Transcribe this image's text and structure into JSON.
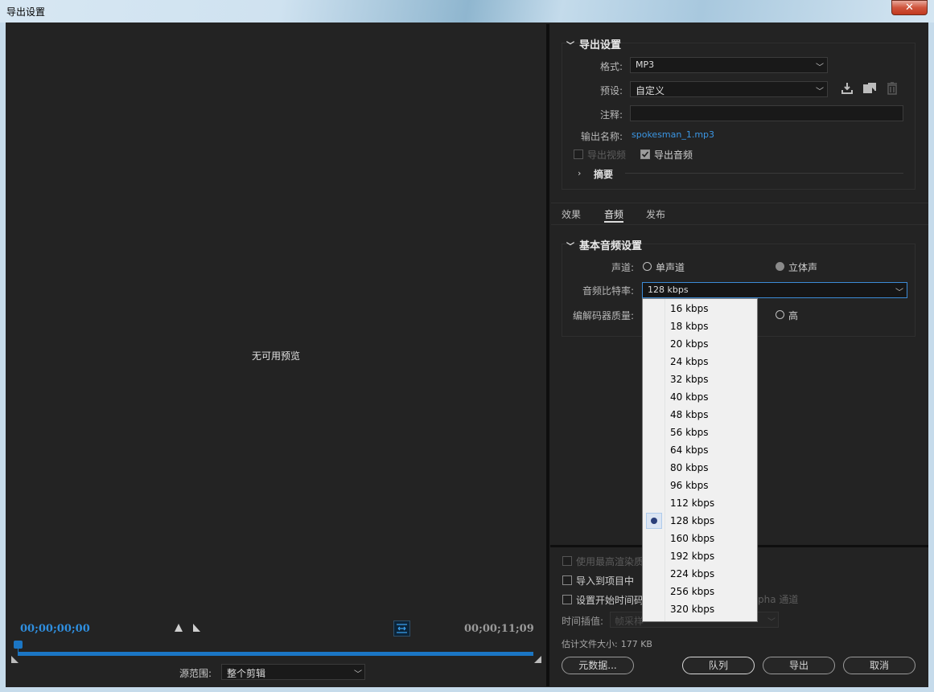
{
  "window": {
    "title": "导出设置",
    "close": "✕"
  },
  "preview": {
    "no_preview": "无可用预览",
    "timecode_start": "00;00;00;00",
    "timecode_end": "00;00;11;09",
    "source_range_label": "源范围:",
    "source_range_value": "整个剪辑"
  },
  "export_settings": {
    "header": "导出设置",
    "format_label": "格式:",
    "format_value": "MP3",
    "preset_label": "预设:",
    "preset_value": "自定义",
    "comment_label": "注释:",
    "comment_value": "",
    "output_name_label": "输出名称:",
    "output_name_value": "spokesman_1.mp3",
    "export_video_label": "导出视频",
    "export_video_checked": false,
    "export_audio_label": "导出音频",
    "export_audio_checked": true,
    "summary_label": "摘要"
  },
  "tabs": [
    {
      "label": "效果",
      "active": false
    },
    {
      "label": "音频",
      "active": true
    },
    {
      "label": "发布",
      "active": false
    }
  ],
  "basic_audio": {
    "header": "基本音频设置",
    "channel_label": "声道:",
    "mono_label": "单声道",
    "stereo_label": "立体声",
    "selected_channel": "立体声",
    "bitrate_label": "音频比特率:",
    "bitrate_value": "128 kbps",
    "codec_quality_label": "编解码器质量:",
    "codec_high_label": "高"
  },
  "bitrate_options": [
    "16 kbps",
    "18 kbps",
    "20 kbps",
    "24 kbps",
    "32 kbps",
    "40 kbps",
    "48 kbps",
    "56 kbps",
    "64 kbps",
    "80 kbps",
    "96 kbps",
    "112 kbps",
    "128 kbps",
    "160 kbps",
    "192 kbps",
    "224 kbps",
    "256 kbps",
    "320 kbps"
  ],
  "bitrate_selected": "128 kbps",
  "bottom": {
    "max_render_label": "使用最高渲染质",
    "import_project_label": "导入到项目中",
    "set_start_tc_label": "设置开始时间码",
    "alpha_label": "pha 通道",
    "interp_label": "时间插值:",
    "interp_value": "帧采样",
    "file_size_label": "估计文件大小:",
    "file_size_value": "177 KB",
    "metadata_btn": "元数据...",
    "queue_btn": "队列",
    "export_btn": "导出",
    "cancel_btn": "取消"
  },
  "colors": {
    "accent_blue": "#1b76c4",
    "link_blue": "#3b96e3",
    "panel_bg": "#232323"
  }
}
